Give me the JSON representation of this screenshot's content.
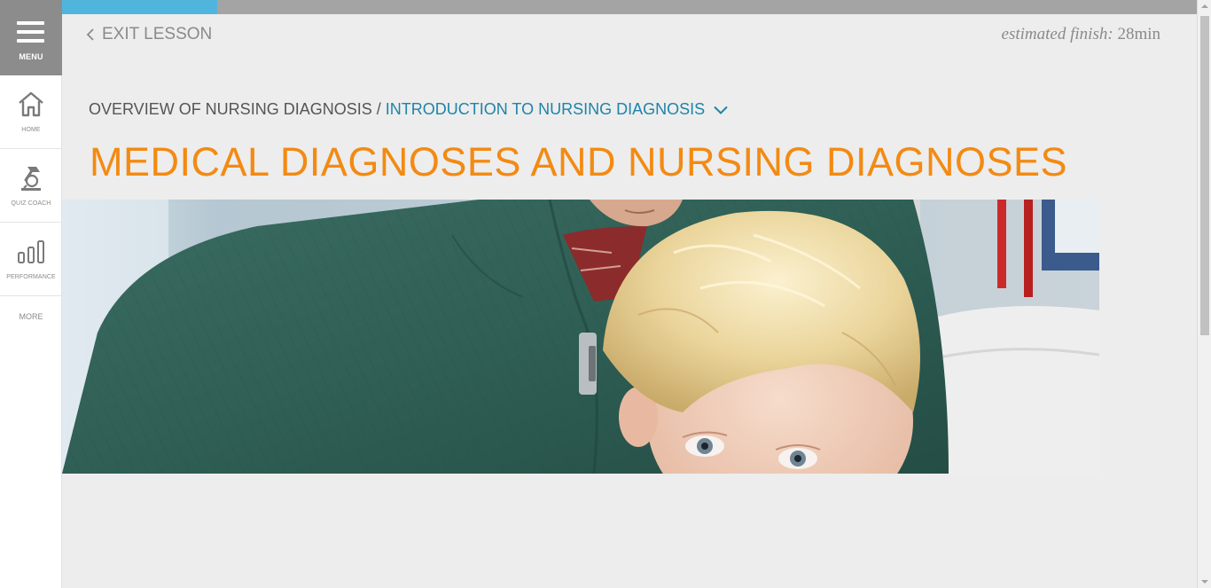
{
  "sidebar": {
    "menu_label": "MENU",
    "items": [
      {
        "label": "HOME",
        "icon": "home-icon"
      },
      {
        "label": "QUIZ COACH",
        "icon": "quiz-coach-icon"
      },
      {
        "label": "PERFORMANCE",
        "icon": "bar-chart-icon"
      }
    ],
    "more_label": "MORE"
  },
  "progress": {
    "fraction": 0.137,
    "fill_color": "#50b5dc",
    "track_color": "#a4a4a4"
  },
  "header": {
    "exit_label": "EXIT LESSON",
    "estimate_label": "estimated finish:",
    "estimate_value": "28min"
  },
  "breadcrumb": {
    "parent": "OVERVIEW OF NURSING DIAGNOSIS",
    "separator": "/",
    "current": "INTRODUCTION TO NURSING DIAGNOSIS"
  },
  "page": {
    "title": "MEDICAL DIAGNOSES AND NURSING DIAGNOSES"
  },
  "colors": {
    "accent_orange": "#f38a13",
    "link_blue": "#1e84a8"
  }
}
